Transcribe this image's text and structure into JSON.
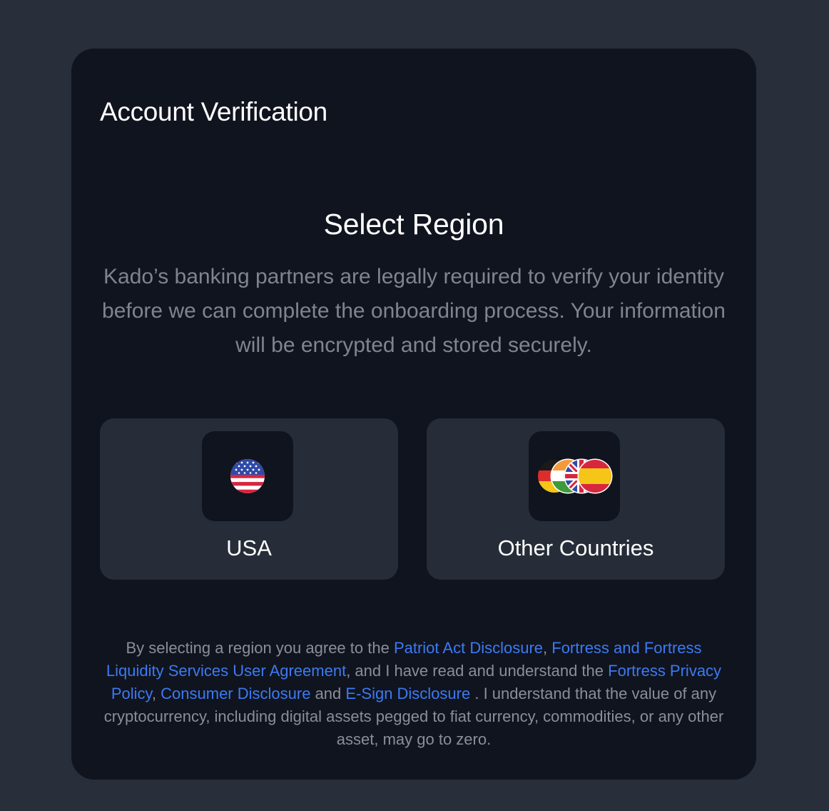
{
  "header": {
    "title": "Account Verification"
  },
  "region_select": {
    "title": "Select Region",
    "description": "Kado’s banking partners are legally required to verify your identity before we can complete the onboarding process. Your information will be encrypted and stored securely."
  },
  "regions": [
    {
      "label": "USA",
      "icon": "us-flag-icon"
    },
    {
      "label": "Other Countries",
      "icon": "multi-country-flags-icon"
    }
  ],
  "disclaimer": {
    "part1": "By selecting a region you agree to the ",
    "link1": "Patriot Act Disclosure",
    "part2": ", ",
    "link2": "Fortress and Fortress Liquidity Services User Agreement",
    "part3": ", and I have read and understand the ",
    "link3": "Fortress Privacy Policy",
    "part4": ", ",
    "link4": "Consumer Disclosure",
    "part5": " and ",
    "link5": "E-Sign Disclosure",
    "part6": " . I understand that the value of any cryptocurrency, including digital assets pegged to fiat currency, commodities, or any other asset, may go to zero."
  },
  "colors": {
    "page_background": "#282f3a",
    "card_background": "#10141f",
    "tile_background": "#262d38",
    "link": "#3c7af2",
    "muted_text": "#7f848f"
  }
}
